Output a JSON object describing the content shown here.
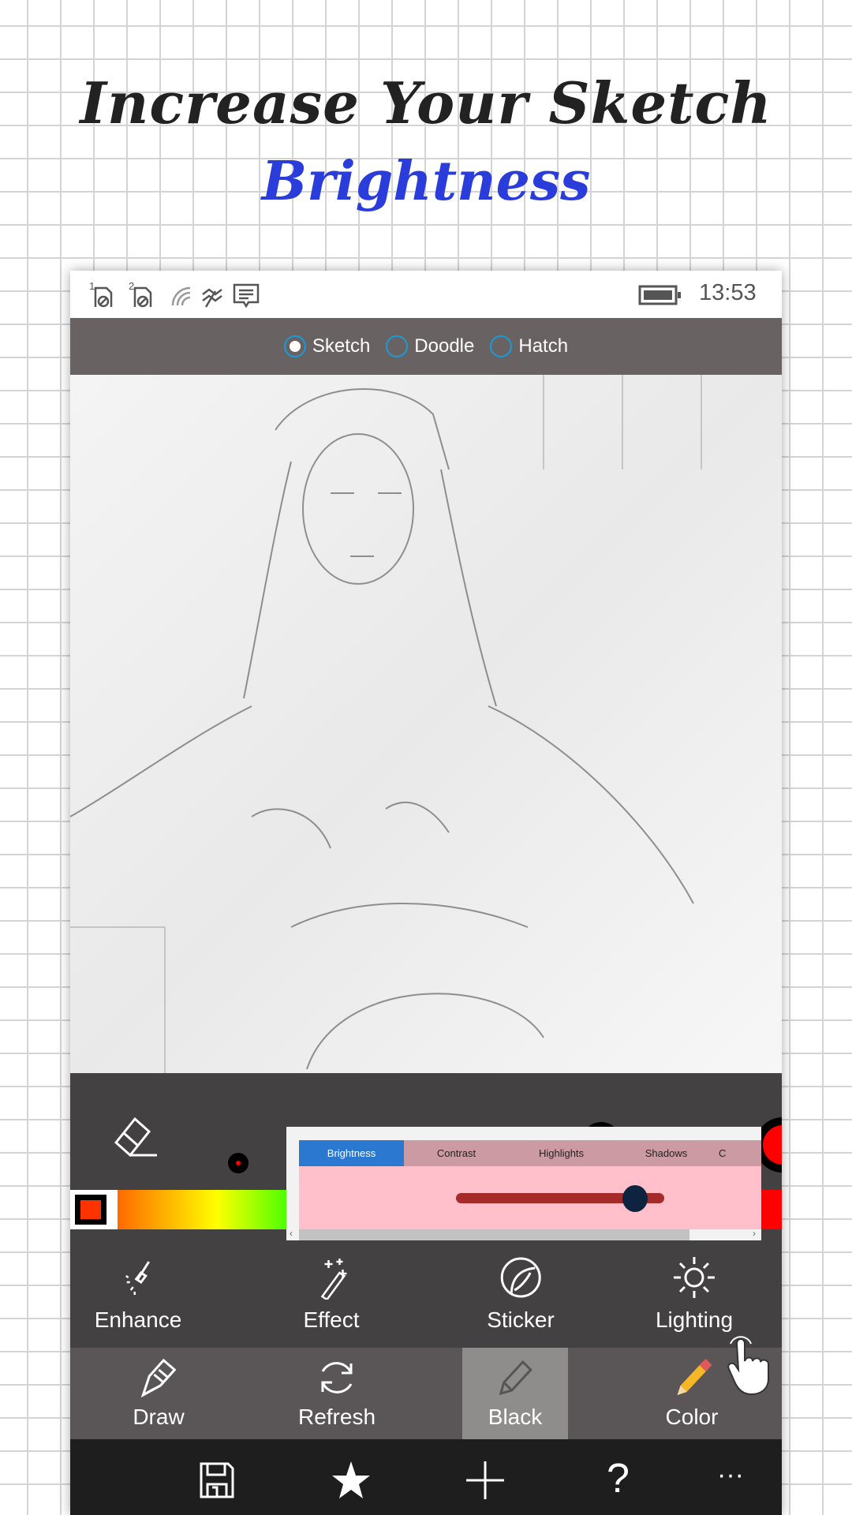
{
  "headline": {
    "line1": "Increase Your Sketch",
    "line2": "Brightness"
  },
  "colors": {
    "accent": "#2a3ddb",
    "radio": "#1a9ad6",
    "active_tab": "#2a78d0",
    "slider_track": "#a52a2a",
    "panel_bg": "#ffc0cb"
  },
  "status_bar": {
    "icons": [
      "sim1-blocked-icon",
      "sim2-blocked-icon",
      "wifi-icon",
      "data-icon",
      "message-icon",
      "battery-icon"
    ],
    "sim1": "1",
    "sim2": "2",
    "time": "13:53"
  },
  "modes": {
    "selected": "Sketch",
    "options": [
      {
        "label": "Sketch",
        "checked": true
      },
      {
        "label": "Doodle",
        "checked": false
      },
      {
        "label": "Hatch",
        "checked": false
      }
    ]
  },
  "adjust_panel": {
    "tabs": [
      "Brightness",
      "Contrast",
      "Highlights",
      "Shadows",
      "C"
    ],
    "active_tab": "Brightness",
    "slider_value": 0.86
  },
  "tools_row1": [
    {
      "label": "Enhance",
      "icon": "enhance-brush-icon"
    },
    {
      "label": "Effect",
      "icon": "magic-wand-icon"
    },
    {
      "label": "Sticker",
      "icon": "sticker-icon"
    },
    {
      "label": "Lighting",
      "icon": "sun-icon"
    }
  ],
  "tools_row2": [
    {
      "label": "Draw",
      "icon": "draw-pen-icon"
    },
    {
      "label": "Refresh",
      "icon": "refresh-icon"
    },
    {
      "label": "Black",
      "icon": "pencil-outline-icon",
      "active": true
    },
    {
      "label": "Color",
      "icon": "color-pencil-icon"
    }
  ],
  "bottom_bar": [
    "save-icon",
    "star-icon",
    "plus-icon",
    "help-icon",
    "more-icon"
  ],
  "bottom_bar_glyphs": {
    "help": "?",
    "more": "···"
  }
}
